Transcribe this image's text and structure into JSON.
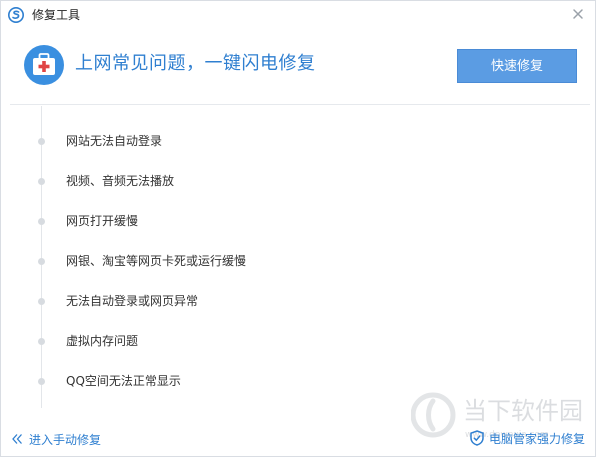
{
  "window": {
    "title": "修复工具",
    "close_symbol": "×"
  },
  "header": {
    "icon": "first-aid-kit-icon",
    "headline": "上网常见问题，一键闪电修复",
    "quick_fix_label": "快速修复"
  },
  "issues": [
    {
      "label": "网站无法自动登录"
    },
    {
      "label": "视频、音频无法播放"
    },
    {
      "label": "网页打开缓慢"
    },
    {
      "label": "网银、淘宝等网页卡死或运行缓慢"
    },
    {
      "label": "无法自动登录或网页异常"
    },
    {
      "label": "虚拟内存问题"
    },
    {
      "label": "QQ空间无法正常显示"
    }
  ],
  "footer": {
    "manual_link": "进入手动修复",
    "brand_label": "电脑管家强力修复"
  },
  "watermark": {
    "text": "当下软件园",
    "url": "www.downxia.com"
  },
  "colors": {
    "accent": "#2f7fd0",
    "button": "#5b9ce3",
    "icon_bg": "#3a8fe0",
    "kit_red": "#e04545"
  }
}
